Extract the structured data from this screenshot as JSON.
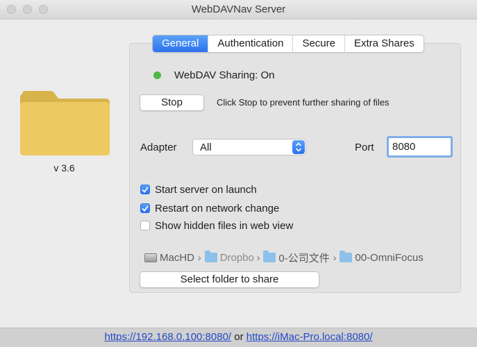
{
  "window": {
    "title": "WebDAVNav Server"
  },
  "sidebar": {
    "version": "v 3.6"
  },
  "tabs": [
    {
      "label": "General",
      "active": true
    },
    {
      "label": "Authentication",
      "active": false
    },
    {
      "label": "Secure",
      "active": false
    },
    {
      "label": "Extra Shares",
      "active": false
    }
  ],
  "status": {
    "text": "WebDAV Sharing: On",
    "color": "#4fb743"
  },
  "stop": {
    "label": "Stop",
    "hint": "Click Stop to prevent further sharing of files"
  },
  "adapter": {
    "label": "Adapter",
    "value": "All"
  },
  "port": {
    "label": "Port",
    "value": "8080"
  },
  "options": [
    {
      "label": "Start server on launch",
      "checked": true
    },
    {
      "label": "Restart on network change",
      "checked": true
    },
    {
      "label": "Show hidden files in web view",
      "checked": false
    }
  ],
  "path": [
    "MacHD",
    "Dropbox",
    "0-公司文件",
    "00-OmniFocus"
  ],
  "select_folder": {
    "label": "Select folder to share"
  },
  "footer": {
    "url1": "https://192.168.0.100:8080/",
    "connector": "or",
    "url2": "https://iMac-Pro.local:8080/"
  },
  "colors": {
    "accent": "#2c71ee",
    "folder": "#e6c45e"
  }
}
